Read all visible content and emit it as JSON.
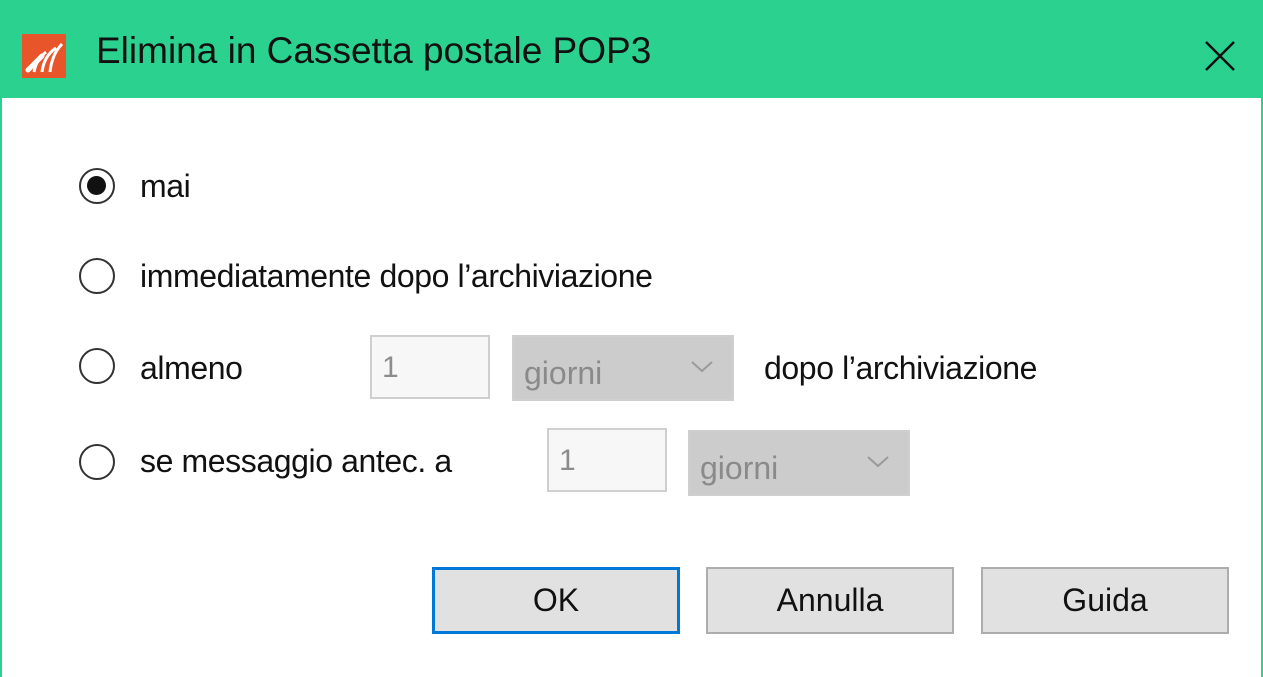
{
  "window": {
    "title": "Elimina in Cassetta postale POP3",
    "app_icon": "mailstore-logo-icon",
    "close_icon": "close-icon",
    "accent_color": "#2bd28f"
  },
  "options": {
    "never": {
      "label": "mai",
      "selected": true
    },
    "immediately": {
      "label": "immediatamente dopo l’archiviazione",
      "selected": false
    },
    "at_least": {
      "label": "almeno",
      "value": "1",
      "unit": "giorni",
      "suffix": "dopo l’archiviazione",
      "selected": false
    },
    "older_than": {
      "label": "se messaggio antec. a",
      "value": "1",
      "unit": "giorni",
      "selected": false
    }
  },
  "buttons": {
    "ok": "OK",
    "cancel": "Annulla",
    "help": "Guida"
  }
}
